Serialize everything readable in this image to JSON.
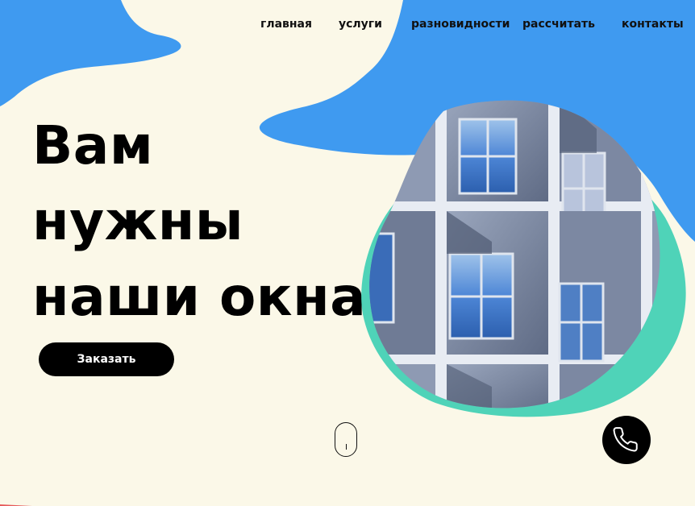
{
  "nav": {
    "items": [
      {
        "label": "главная"
      },
      {
        "label": "услуги"
      },
      {
        "label": "разновидности"
      },
      {
        "label": "рассчитать"
      },
      {
        "label": "контакты"
      }
    ]
  },
  "hero": {
    "title_lines": [
      "Вам",
      "нужны",
      "наши окна"
    ],
    "order_button": "Заказать"
  },
  "icons": {
    "phone": "phone-icon",
    "scroll": "mouse-scroll-icon"
  },
  "colors": {
    "background": "#fbf8e8",
    "blue_blob": "#3f9af0",
    "teal_blob": "#4fd3b8",
    "button": "#000000"
  }
}
